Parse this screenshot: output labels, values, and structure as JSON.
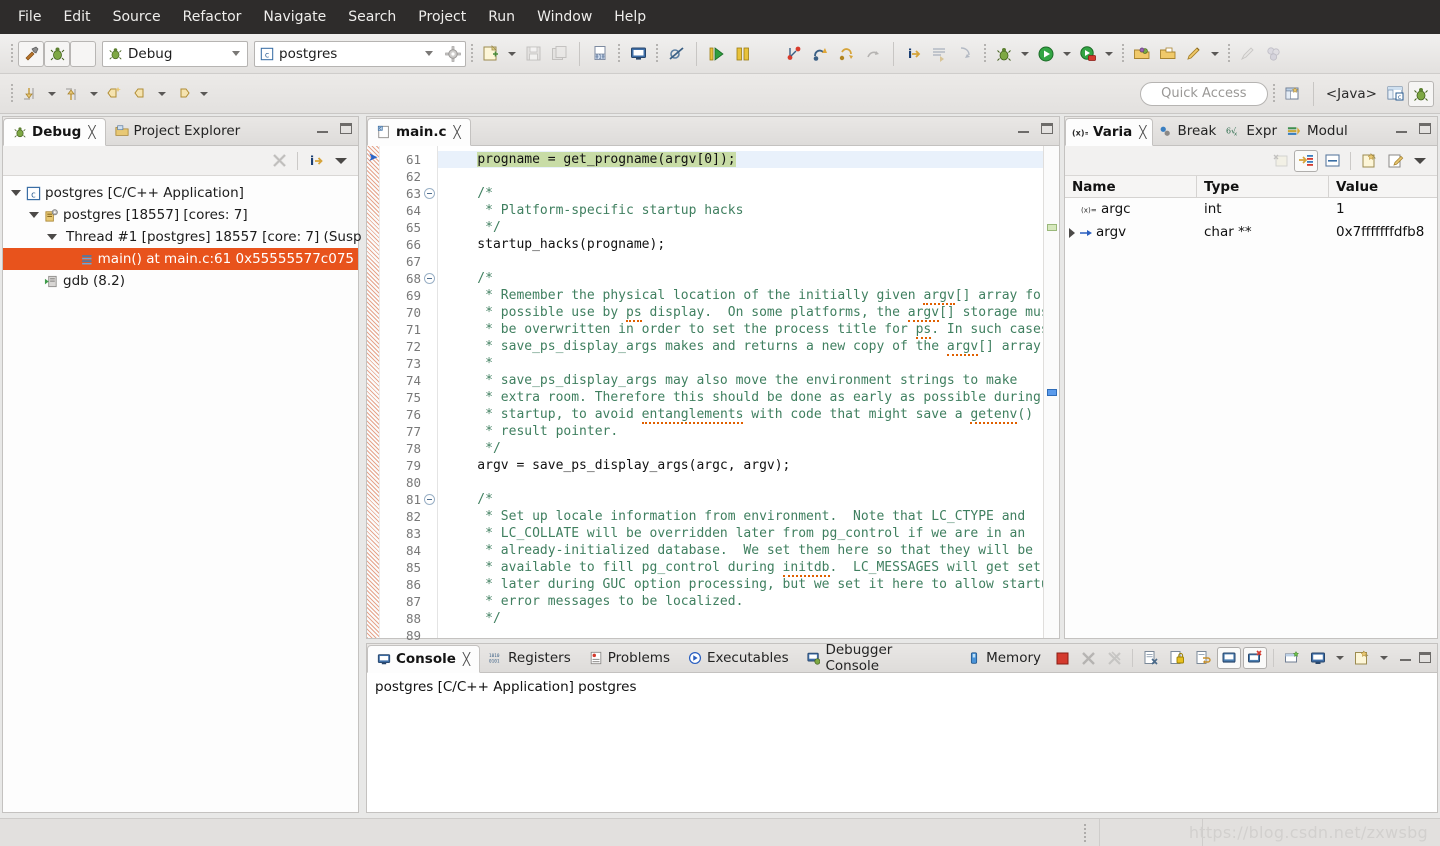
{
  "menu": {
    "items": [
      "File",
      "Edit",
      "Source",
      "Refactor",
      "Navigate",
      "Search",
      "Project",
      "Run",
      "Window",
      "Help"
    ]
  },
  "toolbar": {
    "build_icon": "hammer-icon",
    "debug_icon": "bug-icon",
    "terminate_icon": "stop-icon",
    "launch_mode": "Debug",
    "launch_config": "postgres",
    "new_icon": "new-file-icon",
    "save_icon": "save-icon",
    "save_all_icon": "save-all-icon",
    "binary_icon": "binary-file-icon",
    "console_icon": "console-icon",
    "skip_breakpoints_icon": "skip-breakpoints-icon",
    "resume_icon": "resume-icon",
    "suspend_icon": "suspend-icon",
    "stop_icon": "terminate-icon",
    "step_into_icon": "step-into-icon",
    "step_over_icon": "step-over-icon",
    "step_return_icon": "step-return-icon",
    "instruction_step_icon": "instruction-step-icon",
    "info_icon": "info-step-icon",
    "next_edit_icon": "next-annotation-icon",
    "prev_edit_icon": "previous-annotation-icon",
    "debug_launch_icon": "debug-launch-icon",
    "run_launch_icon": "run-launch-icon",
    "profile_icon": "profile-launch-icon",
    "open_type_icon": "open-type-icon",
    "open_folder_icon": "open-resource-icon",
    "search_icon": "search-icon",
    "pencil_icon": "edit-icon",
    "cluster_icon": "cluster-icon"
  },
  "toolbar2": {
    "back_icon": "back-history-icon",
    "forward_icon": "forward-history-icon",
    "down_icon": "next-member-icon",
    "up_icon": "previous-member-icon",
    "last_edit_icon": "last-edit-location-icon",
    "quick_access_placeholder": "Quick Access",
    "new_perspective_icon": "open-perspective-icon",
    "perspective_java": "<Java>",
    "perspective_java_icon": "java-perspective-icon",
    "perspective_debug_icon": "debug-perspective-icon"
  },
  "debug_view": {
    "tabs": [
      {
        "label": "Debug",
        "icon": "bug-icon",
        "active": true,
        "closable": true
      },
      {
        "label": "Project Explorer",
        "icon": "project-explorer-icon",
        "active": false,
        "closable": false
      }
    ],
    "toolbar": {
      "disconnect_icon": "disconnect-icon",
      "info_icon": "info-icon",
      "view_menu_icon": "view-menu-icon"
    },
    "tree": [
      {
        "depth": 0,
        "expander": "down",
        "icon": "c-launch-icon",
        "label": "postgres [C/C++ Application]",
        "selected": false
      },
      {
        "depth": 1,
        "expander": "down",
        "icon": "process-icon",
        "label": "postgres [18557] [cores: 7]",
        "selected": false
      },
      {
        "depth": 2,
        "expander": "down",
        "icon": "thread-icon",
        "label": "Thread #1 [postgres] 18557 [core: 7] (Susp",
        "selected": false
      },
      {
        "depth": 3,
        "expander": "none",
        "icon": "stack-frame-icon",
        "label": "main() at main.c:61 0x55555577c075",
        "selected": true
      },
      {
        "depth": 1,
        "expander": "none",
        "icon": "gdb-icon",
        "label": "gdb (8.2)",
        "selected": false
      }
    ]
  },
  "editor": {
    "tab": {
      "label": "main.c",
      "icon": "c-file-icon",
      "closable": true
    },
    "first_line": 61,
    "lines": [
      {
        "n": 61,
        "text": "    progname = get_progname(argv[0]);",
        "exec": true,
        "highlight": true,
        "fold": false
      },
      {
        "n": 62,
        "text": "",
        "exec": false,
        "highlight": false,
        "fold": false
      },
      {
        "n": 63,
        "text": "    /*",
        "exec": false,
        "highlight": false,
        "fold": true,
        "comment": true
      },
      {
        "n": 64,
        "text": "     * Platform-specific startup hacks",
        "exec": false,
        "highlight": false,
        "fold": false,
        "comment": true
      },
      {
        "n": 65,
        "text": "     */",
        "exec": false,
        "highlight": false,
        "fold": false,
        "comment": true
      },
      {
        "n": 66,
        "text": "    startup_hacks(progname);",
        "exec": false,
        "highlight": false,
        "fold": false
      },
      {
        "n": 67,
        "text": "",
        "exec": false,
        "highlight": false,
        "fold": false
      },
      {
        "n": 68,
        "text": "    /*",
        "exec": false,
        "highlight": false,
        "fold": true,
        "comment": true
      },
      {
        "n": 69,
        "text": "     * Remember the physical location of the initially given argv[] array for",
        "exec": false,
        "highlight": false,
        "fold": false,
        "comment": true
      },
      {
        "n": 70,
        "text": "     * possible use by ps display.  On some platforms, the argv[] storage must",
        "exec": false,
        "highlight": false,
        "fold": false,
        "comment": true
      },
      {
        "n": 71,
        "text": "     * be overwritten in order to set the process title for ps. In such cases",
        "exec": false,
        "highlight": false,
        "fold": false,
        "comment": true
      },
      {
        "n": 72,
        "text": "     * save_ps_display_args makes and returns a new copy of the argv[] array.",
        "exec": false,
        "highlight": false,
        "fold": false,
        "comment": true
      },
      {
        "n": 73,
        "text": "     *",
        "exec": false,
        "highlight": false,
        "fold": false,
        "comment": true
      },
      {
        "n": 74,
        "text": "     * save_ps_display_args may also move the environment strings to make",
        "exec": false,
        "highlight": false,
        "fold": false,
        "comment": true
      },
      {
        "n": 75,
        "text": "     * extra room. Therefore this should be done as early as possible during",
        "exec": false,
        "highlight": false,
        "fold": false,
        "comment": true
      },
      {
        "n": 76,
        "text": "     * startup, to avoid entanglements with code that might save a getenv()",
        "exec": false,
        "highlight": false,
        "fold": false,
        "comment": true
      },
      {
        "n": 77,
        "text": "     * result pointer.",
        "exec": false,
        "highlight": false,
        "fold": false,
        "comment": true
      },
      {
        "n": 78,
        "text": "     */",
        "exec": false,
        "highlight": false,
        "fold": false,
        "comment": true
      },
      {
        "n": 79,
        "text": "    argv = save_ps_display_args(argc, argv);",
        "exec": false,
        "highlight": false,
        "fold": false
      },
      {
        "n": 80,
        "text": "",
        "exec": false,
        "highlight": false,
        "fold": false
      },
      {
        "n": 81,
        "text": "    /*",
        "exec": false,
        "highlight": false,
        "fold": true,
        "comment": true
      },
      {
        "n": 82,
        "text": "     * Set up locale information from environment.  Note that LC_CTYPE and",
        "exec": false,
        "highlight": false,
        "fold": false,
        "comment": true
      },
      {
        "n": 83,
        "text": "     * LC_COLLATE will be overridden later from pg_control if we are in an",
        "exec": false,
        "highlight": false,
        "fold": false,
        "comment": true
      },
      {
        "n": 84,
        "text": "     * already-initialized database.  We set them here so that they will be",
        "exec": false,
        "highlight": false,
        "fold": false,
        "comment": true
      },
      {
        "n": 85,
        "text": "     * available to fill pg_control during initdb.  LC_MESSAGES will get set",
        "exec": false,
        "highlight": false,
        "fold": false,
        "comment": true
      },
      {
        "n": 86,
        "text": "     * later during GUC option processing, but we set it here to allow startup",
        "exec": false,
        "highlight": false,
        "fold": false,
        "comment": true
      },
      {
        "n": 87,
        "text": "     * error messages to be localized.",
        "exec": false,
        "highlight": false,
        "fold": false,
        "comment": true
      },
      {
        "n": 88,
        "text": "     */",
        "exec": false,
        "highlight": false,
        "fold": false,
        "comment": true
      },
      {
        "n": 89,
        "text": "",
        "exec": false,
        "highlight": false,
        "fold": false
      }
    ]
  },
  "variables_view": {
    "tabs": [
      {
        "label": "Varia",
        "icon": "variables-icon",
        "active": true,
        "closable": true
      },
      {
        "label": "Break",
        "icon": "breakpoints-icon",
        "active": false,
        "closable": false
      },
      {
        "label": "Expr",
        "icon": "expressions-icon",
        "active": false,
        "closable": false
      },
      {
        "label": "Modul",
        "icon": "modules-icon",
        "active": false,
        "closable": false
      }
    ],
    "toolbar": {
      "collapse_icon": "collapse-all-icon",
      "layout_icon": "show-type-names-icon",
      "detail_pane_icon": "detail-pane-icon",
      "new_icon": "new-watch-icon",
      "edit_icon": "edit-watch-icon",
      "menu_icon": "view-menu-icon"
    },
    "columns": [
      "Name",
      "Type",
      "Value"
    ],
    "rows": [
      {
        "expander": "none",
        "icon": "variable-icon",
        "name": "argc",
        "type": "int",
        "value": "1"
      },
      {
        "expander": "right",
        "icon": "pointer-icon",
        "name": "argv",
        "type": "char **",
        "value": "0x7fffffffdfb8"
      }
    ]
  },
  "console_view": {
    "tabs": [
      {
        "label": "Console",
        "icon": "console-icon",
        "active": true,
        "closable": true
      },
      {
        "label": "Registers",
        "icon": "registers-icon",
        "active": false,
        "closable": false
      },
      {
        "label": "Problems",
        "icon": "problems-icon",
        "active": false,
        "closable": false
      },
      {
        "label": "Executables",
        "icon": "executables-icon",
        "active": false,
        "closable": false
      },
      {
        "label": "Debugger Console",
        "icon": "debugger-console-icon",
        "active": false,
        "closable": false
      },
      {
        "label": "Memory",
        "icon": "memory-icon",
        "active": false,
        "closable": false
      }
    ],
    "toolbar": {
      "terminate_icon": "terminate-icon",
      "remove_icon": "remove-launch-icon",
      "remove_all_icon": "remove-all-terminated-icon",
      "clear_icon": "clear-console-icon",
      "lock_icon": "scroll-lock-icon",
      "wrap_icon": "word-wrap-icon",
      "pin_icon": "pin-console-icon",
      "display_icon": "display-selected-console-icon",
      "open_console_icon": "open-console-icon",
      "show_console_icon": "show-console-icon",
      "new_console_icon": "new-console-view-icon"
    },
    "output": "postgres [C/C++ Application] postgres"
  },
  "statusbar": {
    "watermark": "https://blog.csdn.net/zxwsbg"
  },
  "colors": {
    "menubar_bg": "#2e2c2b",
    "selection_orange": "#e8531c",
    "exec_line_bg": "#e9f1fb",
    "exec_text_bg": "#c8dca6",
    "comment_green": "#3f7f5f",
    "spell_squiggle": "#e06000",
    "overview_green": "#c8dca6",
    "overview_blue": "#4a90e2"
  }
}
